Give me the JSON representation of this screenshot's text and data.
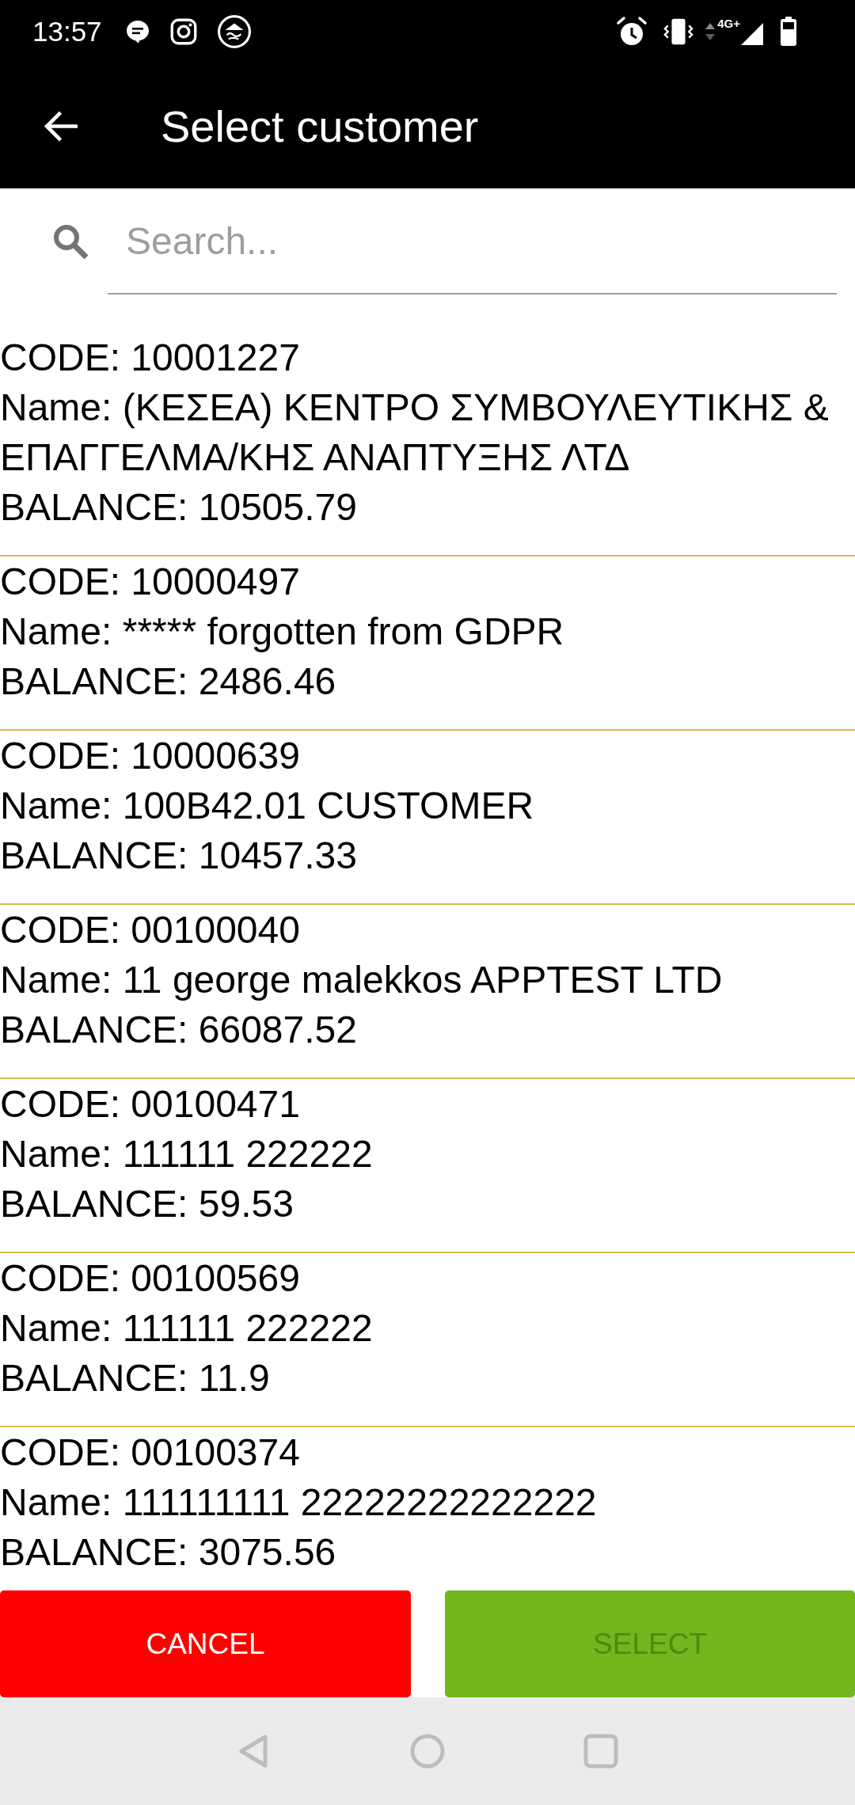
{
  "status_bar": {
    "time": "13:57",
    "network": "4G+"
  },
  "app_bar": {
    "title": "Select customer"
  },
  "search": {
    "placeholder": "Search..."
  },
  "customers": [
    {
      "code": "CODE: 10001227",
      "name": "Name: (ΚΕΣΕΑ) ΚΕΝΤΡΟ ΣΥΜΒΟΥΛΕΥΤΙΚΗΣ & ΕΠΑΓΓΕΛΜΑ/ΚΗΣ ΑΝΑΠΤΥΞΗΣ ΛΤΔ",
      "balance": "BALANCE: 10505.79",
      "selected": false
    },
    {
      "code": "CODE: 10000497",
      "name": "Name: ***** forgotten from GDPR",
      "balance": "BALANCE: 2486.46",
      "selected": false
    },
    {
      "code": "CODE: 10000639",
      "name": "Name: 100B42.01 CUSTOMER",
      "balance": "BALANCE: 10457.33",
      "selected": false
    },
    {
      "code": "CODE: 00100040",
      "name": "Name: 11 george malekkos APPTEST LTD",
      "balance": "BALANCE: 66087.52",
      "selected": false
    },
    {
      "code": "CODE: 00100471",
      "name": "Name: 111111 222222",
      "balance": "BALANCE: 59.53",
      "selected": false
    },
    {
      "code": "CODE: 00100569",
      "name": "Name: 111111 222222",
      "balance": "BALANCE: 11.9",
      "selected": false
    },
    {
      "code": "CODE: 00100374",
      "name": "Name: 111111111 22222222222222",
      "balance": "BALANCE: 3075.56",
      "selected": false
    }
  ],
  "buttons": [
    {
      "kind": "cancel",
      "label": "CANCEL",
      "disabled": false
    },
    {
      "kind": "select",
      "label": "SELECT",
      "disabled": true
    }
  ]
}
